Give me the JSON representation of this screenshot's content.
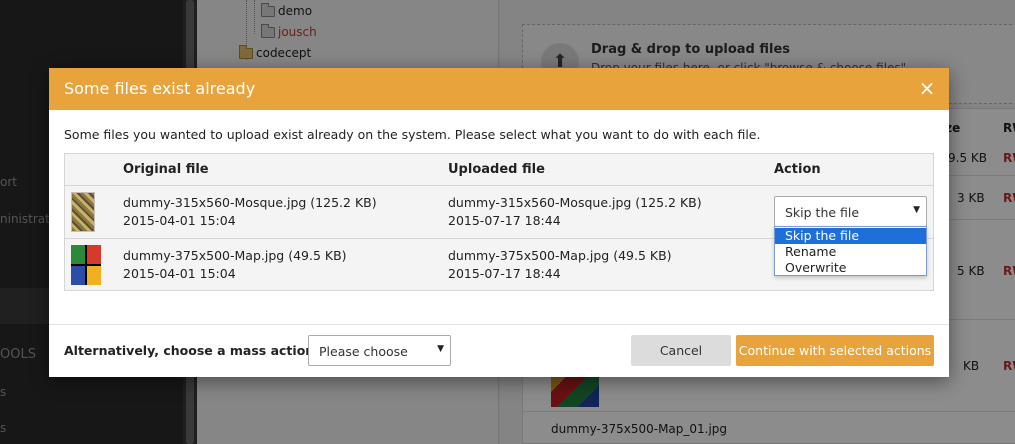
{
  "background": {
    "sidebar_items": [
      "ort",
      "ninistratio",
      "OOLS",
      "s",
      "s"
    ],
    "tree": {
      "folders": [
        "demo",
        "jousch",
        "codecept"
      ]
    },
    "dropzone": {
      "title": "Drag & drop to upload files",
      "subtitle": "Drop your files here, or click \"browse & choose files\"",
      "icon": "upload-icon"
    },
    "file_table": {
      "size_header": "ize",
      "rw_header": "RW",
      "sizes": [
        "9.5 KB",
        "3 KB",
        "5 KB",
        "KB"
      ],
      "rw_values": [
        "RW",
        "RW",
        "RW",
        "RW"
      ],
      "last_filename": "dummy-375x500-Map_01.jpg"
    }
  },
  "dialog": {
    "title": "Some files exist already",
    "close_icon": "×",
    "description": "Some files you wanted to upload exist already on the system. Please select what you want to do with each file.",
    "columns": [
      "Original file",
      "Uploaded file",
      "Action"
    ],
    "rows": [
      {
        "original_name": "dummy-315x560-Mosque.jpg (125.2 KB)",
        "original_date": "2015-04-01 15:04",
        "uploaded_name": "dummy-315x560-Mosque.jpg (125.2 KB)",
        "uploaded_date": "2015-07-17 18:44",
        "action": "Skip the file"
      },
      {
        "original_name": "dummy-375x500-Map.jpg (49.5 KB)",
        "original_date": "2015-04-01 15:04",
        "uploaded_name": "dummy-375x500-Map.jpg (49.5 KB)",
        "uploaded_date": "2015-07-17 18:44",
        "action": "Skip the file"
      }
    ],
    "action_options": [
      "Skip the file",
      "Rename",
      "Overwrite"
    ],
    "mass_action_label": "Alternatively, choose a mass action:",
    "mass_action_placeholder": "Please choose",
    "cancel_label": "Cancel",
    "continue_label": "Continue with selected actions",
    "accent_color": "#e8a33d"
  }
}
